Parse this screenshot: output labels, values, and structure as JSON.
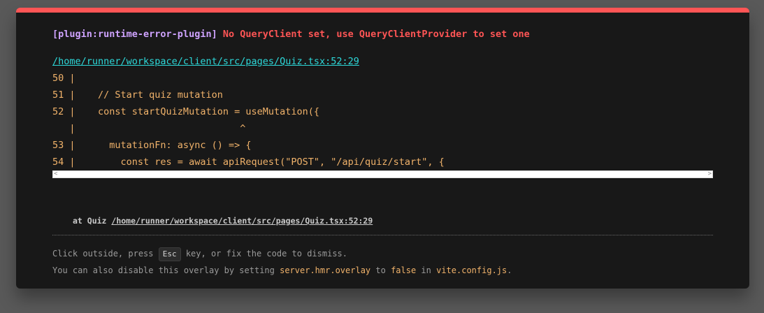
{
  "error": {
    "plugin": "[plugin:runtime-error-plugin]",
    "message": "No QueryClient set, use QueryClientProvider to set one",
    "file": "/home/runner/workspace/client/src/pages/Quiz.tsx:52:29"
  },
  "code_frame": [
    "50 |",
    "51 |    // Start quiz mutation",
    "52 |    const startQuizMutation = useMutation({",
    "   |                             ^",
    "53 |      mutationFn: async () => {",
    "54 |        const res = await apiRequest(\"POST\", \"/api/quiz/start\", {"
  ],
  "scrollbar": {
    "left_arrow": "<",
    "right_arrow": ">"
  },
  "stack": {
    "prefix": "at Quiz ",
    "link": "/home/runner/workspace/client/src/pages/Quiz.tsx:52:29"
  },
  "tips": {
    "line1_before": "Click outside, press ",
    "line1_key": "Esc",
    "line1_after": " key, or fix the code to dismiss.",
    "line2_a": "You can also disable this overlay by setting ",
    "line2_code1": "server.hmr.overlay",
    "line2_b": " to ",
    "line2_code2": "false",
    "line2_c": " in ",
    "line2_code3": "vite.config.js",
    "line2_d": "."
  },
  "colors": {
    "accent_border": "#ff5555",
    "plugin_text": "#cfa3ff",
    "message_text": "#ff5555",
    "file_link": "#2dd9da",
    "code_text": "#f0b26a"
  }
}
